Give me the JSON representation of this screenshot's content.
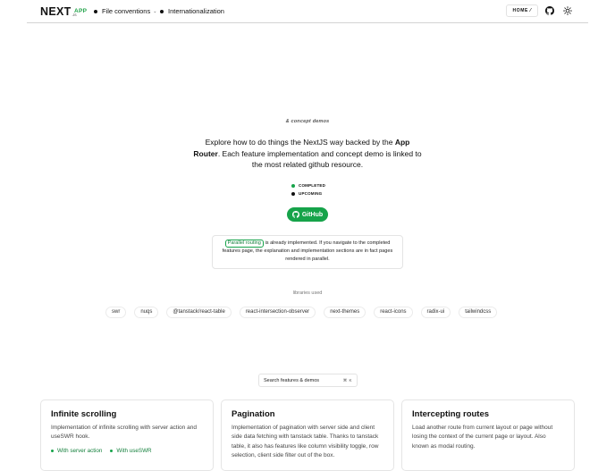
{
  "header": {
    "logo_text": "NEXT",
    "logo_sub": ".JS",
    "app_tag": "APP",
    "nav": [
      {
        "label": "File conventions"
      },
      {
        "label": "Internationalization"
      }
    ],
    "home_label": "HOME",
    "icons": [
      "github-icon",
      "sun-icon"
    ]
  },
  "hero": {
    "concept_label": "& concept demos",
    "intro_part1": "Explore how to do things the NextJS way backed by the",
    "intro_bold": "App Router",
    "intro_part2": ". Each feature implementation and concept demo is linked to the most related github resource.",
    "legend": [
      {
        "label": "COMPLETED",
        "color": "#16a34a"
      },
      {
        "label": "UPCOMING",
        "color": "#111111"
      }
    ],
    "github_label": "GitHub"
  },
  "info": {
    "link_label": "Parallel routing",
    "text": " is already implemented. If you navigate to the completed features page, the explanation and implementation sections are in fact pages rendered in parallel."
  },
  "libraries": {
    "title": "libraries used",
    "items": [
      "swr",
      "nuqs",
      "@tanstack/react-table",
      "react-intersection-observer",
      "next-themes",
      "react-icons",
      "radix-ui",
      "tailwindcss"
    ]
  },
  "search": {
    "placeholder": "Search features & demos",
    "shortcut": "⌘ K"
  },
  "cards": [
    {
      "title": "Infinite scrolling",
      "description": "Implementation of infinite scrolling with server action and useSWR hook.",
      "links": [
        "With server action",
        "With useSWR"
      ]
    },
    {
      "title": "Pagination",
      "description": "Implementation of pagination with server side and client side data fetching with tanstack table. Thanks to tanstack table, it also has features like column visibility toggle, row selection, client side filter out of the box.",
      "links": []
    },
    {
      "title": "Intercepting routes",
      "description": "Load another route from current layout or page without losing the context of the current page or layout. Also known as modal routing.",
      "links": []
    }
  ],
  "colors": {
    "accent": "#16a34a",
    "border": "#e5e5e5"
  }
}
